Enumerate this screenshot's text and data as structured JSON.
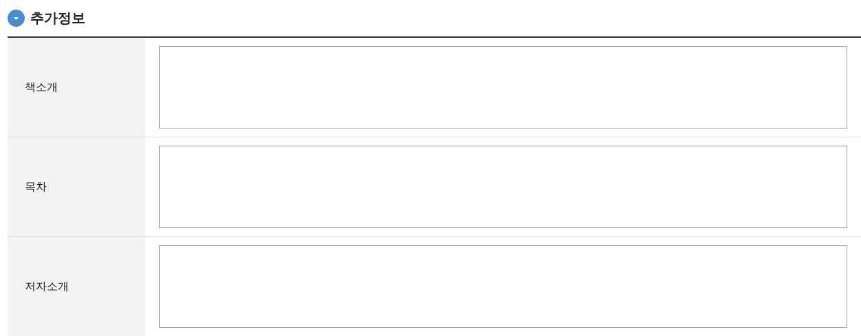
{
  "section": {
    "title": "추가정보"
  },
  "rows": [
    {
      "label": "책소개"
    },
    {
      "label": "목차"
    },
    {
      "label": "저자소개"
    }
  ]
}
